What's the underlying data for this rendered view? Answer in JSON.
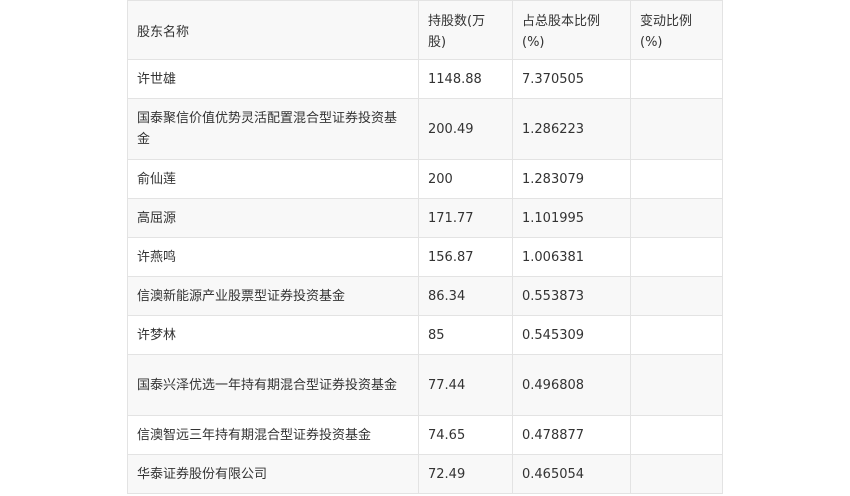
{
  "table": {
    "headers": [
      "股东名称",
      "持股数(万股)",
      "占总股本比例(%)",
      "变动比例(%)"
    ],
    "rows": [
      {
        "name": "许世雄",
        "shares": "1148.88",
        "ratio": "7.370505",
        "change": ""
      },
      {
        "name": "国泰聚信价值优势灵活配置混合型证券投资基金",
        "shares": "200.49",
        "ratio": "1.286223",
        "change": ""
      },
      {
        "name": "俞仙莲",
        "shares": "200",
        "ratio": "1.283079",
        "change": ""
      },
      {
        "name": "高屈源",
        "shares": "171.77",
        "ratio": "1.101995",
        "change": ""
      },
      {
        "name": "许燕鸣",
        "shares": "156.87",
        "ratio": "1.006381",
        "change": ""
      },
      {
        "name": "信澳新能源产业股票型证券投资基金",
        "shares": "86.34",
        "ratio": "0.553873",
        "change": ""
      },
      {
        "name": "许梦林",
        "shares": "85",
        "ratio": "0.545309",
        "change": ""
      },
      {
        "name": "国泰兴泽优选一年持有期混合型证券投资基金",
        "shares": "77.44",
        "ratio": "0.496808",
        "change": ""
      },
      {
        "name": "信澳智远三年持有期混合型证券投资基金",
        "shares": "74.65",
        "ratio": "0.478877",
        "change": ""
      },
      {
        "name": "华泰证券股份有限公司",
        "shares": "72.49",
        "ratio": "0.465054",
        "change": ""
      }
    ]
  }
}
